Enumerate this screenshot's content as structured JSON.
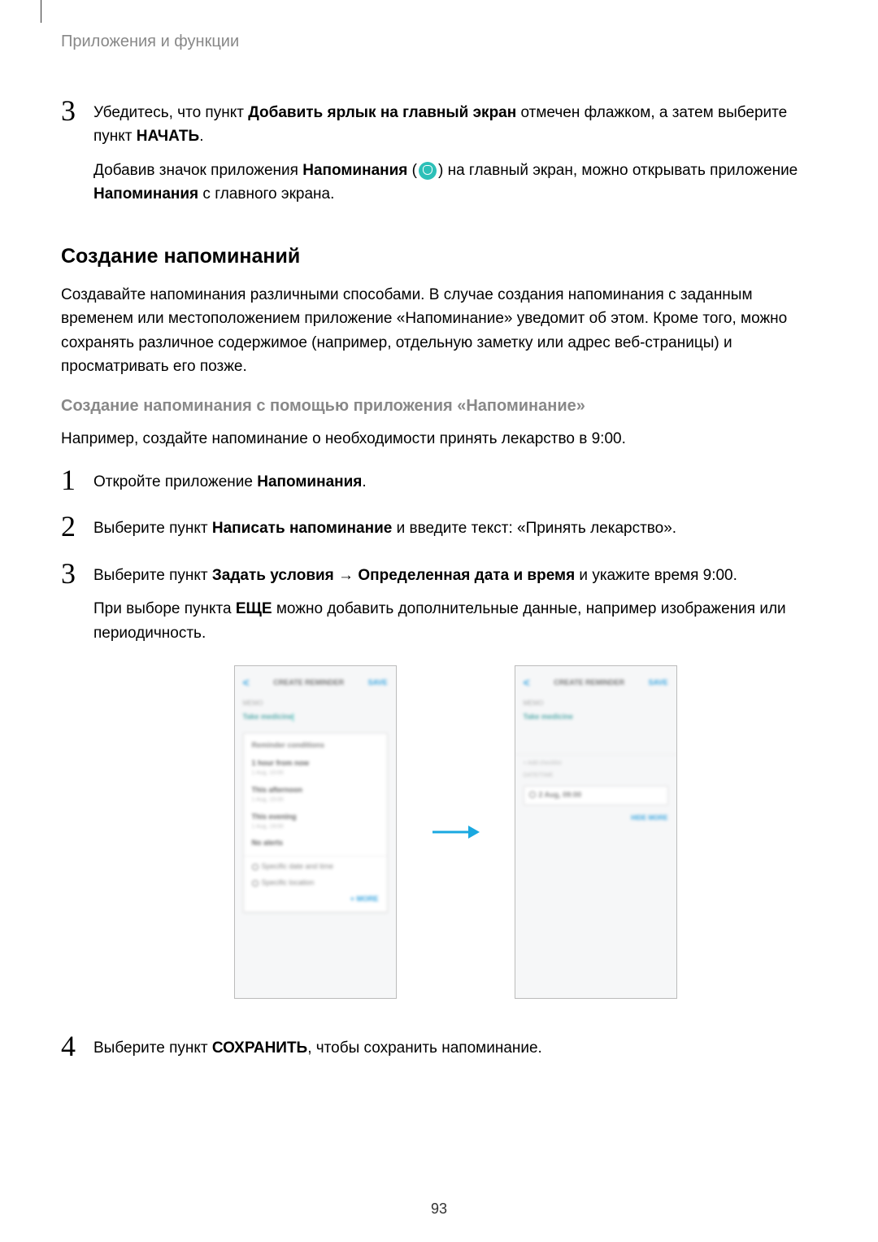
{
  "breadcrumb": "Приложения и функции",
  "step3_top": {
    "num": "3",
    "line1_pre": "Убедитесь, что пункт ",
    "line1_bold": "Добавить ярлык на главный экран",
    "line1_post": " отмечен флажком, а затем выберите пункт ",
    "line1_bold2": "НАЧАТЬ",
    "line1_end": ".",
    "line2_pre": "Добавив значок приложения ",
    "line2_bold": "Напоминания",
    "line2_paren_open": " (",
    "line2_paren_close": ") на главный экран, можно открывать приложение ",
    "line2_bold2": "Напоминания",
    "line2_end": " с главного экрана."
  },
  "heading2": "Создание напоминаний",
  "intro_para": "Создавайте напоминания различными способами. В случае создания напоминания с заданным временем или местоположением приложение «Напоминание» уведомит об этом. Кроме того, можно сохранять различное содержимое (например, отдельную заметку или адрес веб-страницы) и просматривать его позже.",
  "heading3": "Создание напоминания с помощью приложения «Напоминание»",
  "example_para": "Например, создайте напоминание о необходимости принять лекарство в 9:00.",
  "step1": {
    "num": "1",
    "pre": "Откройте приложение ",
    "bold": "Напоминания",
    "end": "."
  },
  "step2": {
    "num": "2",
    "pre": "Выберите пункт ",
    "bold": "Написать напоминание",
    "post": " и введите текст: «Принять лекарство»."
  },
  "step3": {
    "num": "3",
    "pre": "Выберите пункт ",
    "bold1": "Задать условия",
    "arrow": " → ",
    "bold2": "Определенная дата и время",
    "post": " и укажите время 9:00.",
    "line2_pre": "При выборе пункта ",
    "line2_bold": "ЕЩЕ",
    "line2_post": " можно добавить дополнительные данные, например изображения или периодичность."
  },
  "step4": {
    "num": "4",
    "pre": "Выберите пункт ",
    "bold": "СОХРАНИТЬ",
    "post": ", чтобы сохранить напоминание."
  },
  "page_number": "93",
  "phone_left": {
    "back": "<",
    "title": "CREATE REMINDER",
    "save": "SAVE",
    "memo_label": "MEMO",
    "input": "Take medicine",
    "conditions": "Reminder conditions",
    "i1t": "1 hour from now",
    "i1s": "1 Aug, 10:00",
    "i2t": "This afternoon",
    "i2s": "1 Aug, 15:00",
    "i3t": "This evening",
    "i3s": "1 Aug, 19:00",
    "i4t": "No alerts",
    "datetime": "Specific date and time",
    "location": "Specific location",
    "more": "+ MORE"
  },
  "phone_right": {
    "back": "<",
    "title": "CREATE REMINDER",
    "save": "SAVE",
    "memo_label": "MEMO",
    "input": "Take medicine",
    "chk": "Add checklist",
    "time_label": "DATE/TIME",
    "chip": "2 Aug, 09:00",
    "hide": "HIDE MORE"
  }
}
